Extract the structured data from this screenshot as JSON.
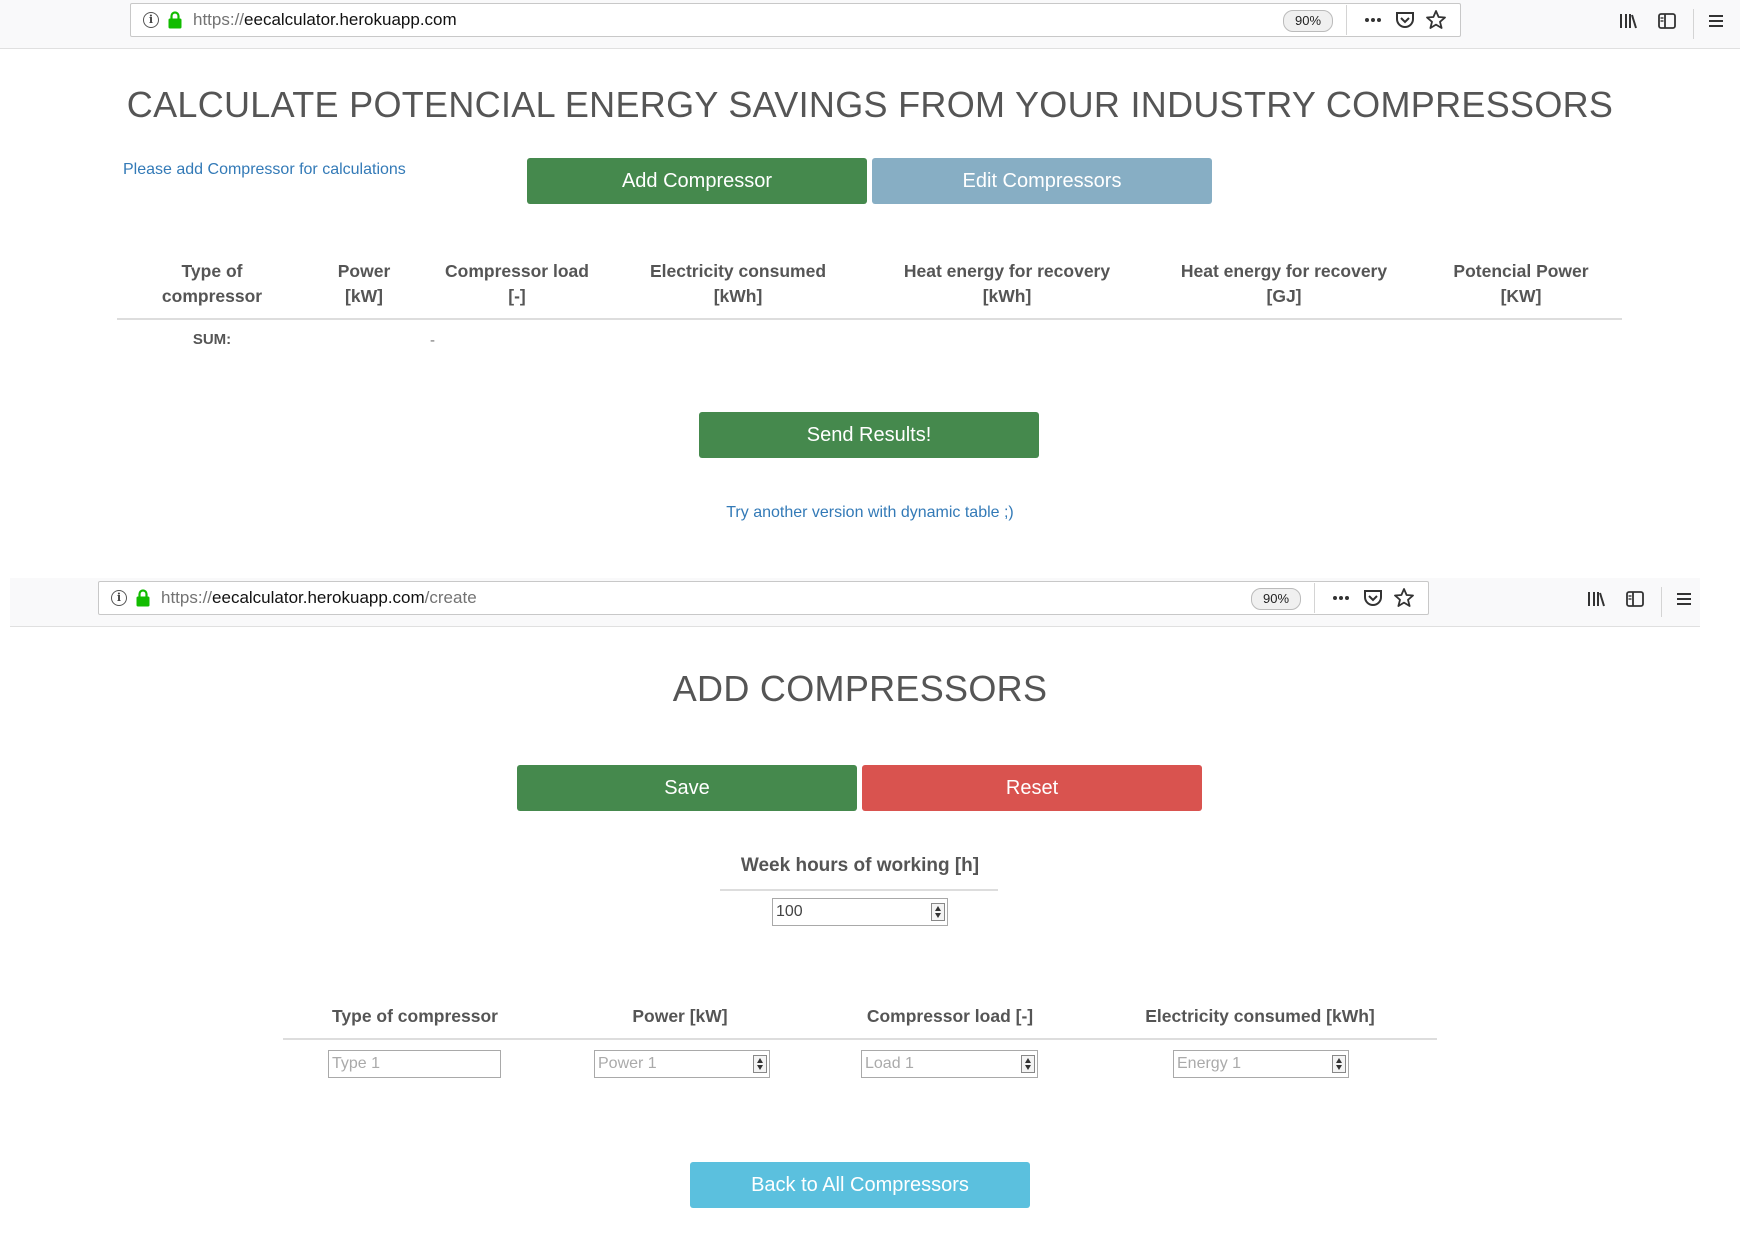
{
  "browser1": {
    "url_scheme": "https://",
    "url_host": "eecalculator.herokuapp.com",
    "url_path": "",
    "zoom": "90%"
  },
  "page1": {
    "title": "CALCULATE POTENCIAL ENERGY SAVINGS FROM YOUR INDUSTRY COMPRESSORS",
    "hint_link": "Please add Compressor for calculations",
    "add_button": "Add Compressor",
    "edit_button": "Edit Compressors",
    "table": {
      "columns": [
        [
          "Type of",
          "compressor"
        ],
        [
          "Power",
          "[kW]"
        ],
        [
          "Compressor load",
          "[-]"
        ],
        [
          "Electricity consumed",
          "[kWh]"
        ],
        [
          "Heat energy for recovery",
          "[kWh]"
        ],
        [
          "Heat energy for recovery",
          "[GJ]"
        ],
        [
          "Potencial Power",
          "[KW]"
        ]
      ],
      "sum_label": "SUM:",
      "sum_load": "-"
    },
    "send_button": "Send Results!",
    "dynamic_link": "Try another version with dynamic table ;)"
  },
  "browser2": {
    "url_scheme": "https://",
    "url_host": "eecalculator.herokuapp.com",
    "url_path": "/create",
    "zoom": "90%"
  },
  "page2": {
    "title": "ADD COMPRESSORS",
    "save_button": "Save",
    "reset_button": "Reset",
    "week_hours_label": "Week hours of working [h]",
    "week_hours_value": "100",
    "columns": [
      "Type of compressor",
      "Power [kW]",
      "Compressor load [-]",
      "Electricity consumed [kWh]"
    ],
    "placeholders": {
      "type": "Type 1",
      "power": "Power 1",
      "load": "Load 1",
      "energy": "Energy 1"
    },
    "back_button": "Back to All Compressors"
  }
}
